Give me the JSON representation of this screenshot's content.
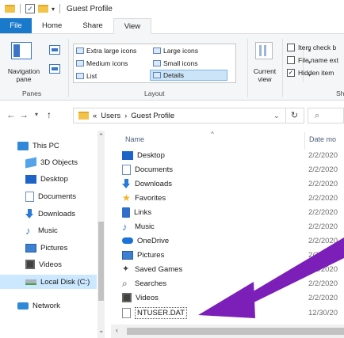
{
  "window": {
    "title": "Guest Profile"
  },
  "ribbon": {
    "tabs": [
      "File",
      "Home",
      "Share",
      "View"
    ],
    "panes": {
      "navigation_pane": "Navigation\npane",
      "group_label": "Panes"
    },
    "layout": {
      "items": [
        "Extra large icons",
        "Large icons",
        "Medium icons",
        "Small icons",
        "List",
        "Details"
      ],
      "selected": "Details",
      "group_label": "Layout"
    },
    "current_view": {
      "label": "Current\nview"
    },
    "show_hide": {
      "item_check_boxes": "Item check b",
      "file_name_extensions": "File name ext",
      "hidden_items": "Hidden item",
      "group_label": "Sh"
    }
  },
  "address": {
    "path": [
      "«",
      "Users",
      "›",
      "Guest Profile"
    ],
    "search_icon": "search-icon"
  },
  "nav_pane": {
    "items": [
      {
        "label": "This PC",
        "icon": "pc-icon"
      },
      {
        "label": "3D Objects",
        "icon": "3d-objects-icon"
      },
      {
        "label": "Desktop",
        "icon": "desktop-icon"
      },
      {
        "label": "Documents",
        "icon": "documents-icon"
      },
      {
        "label": "Downloads",
        "icon": "downloads-icon"
      },
      {
        "label": "Music",
        "icon": "music-icon"
      },
      {
        "label": "Pictures",
        "icon": "pictures-icon"
      },
      {
        "label": "Videos",
        "icon": "videos-icon"
      },
      {
        "label": "Local Disk (C:)",
        "icon": "local-disk-icon",
        "selected": true
      },
      {
        "label": "Network",
        "icon": "network-icon"
      }
    ]
  },
  "file_list": {
    "columns": [
      "Name",
      "Date mo"
    ],
    "rows": [
      {
        "name": "Desktop",
        "date": "2/2/2020",
        "icon": "desktop-icon"
      },
      {
        "name": "Documents",
        "date": "2/2/2020",
        "icon": "documents-icon"
      },
      {
        "name": "Downloads",
        "date": "2/2/2020",
        "icon": "downloads-icon"
      },
      {
        "name": "Favorites",
        "date": "2/2/2020",
        "icon": "favorites-icon"
      },
      {
        "name": "Links",
        "date": "2/2/2020",
        "icon": "links-icon"
      },
      {
        "name": "Music",
        "date": "2/2/2020",
        "icon": "music-icon"
      },
      {
        "name": "OneDrive",
        "date": "2/2/2020",
        "icon": "onedrive-icon"
      },
      {
        "name": "Pictures",
        "date": "2/2/2020",
        "icon": "pictures-icon"
      },
      {
        "name": "Saved Games",
        "date": "2/2/2020",
        "icon": "saved-games-icon"
      },
      {
        "name": "Searches",
        "date": "2/2/2020",
        "icon": "searches-icon"
      },
      {
        "name": "Videos",
        "date": "2/2/2020",
        "icon": "videos-icon"
      },
      {
        "name": "NTUSER.DAT",
        "date": "12/30/20",
        "icon": "file-icon",
        "selected": true
      }
    ]
  },
  "colors": {
    "accent": "#1979ca",
    "arrow": "#7b1fb8",
    "selection": "#cce8ff"
  }
}
